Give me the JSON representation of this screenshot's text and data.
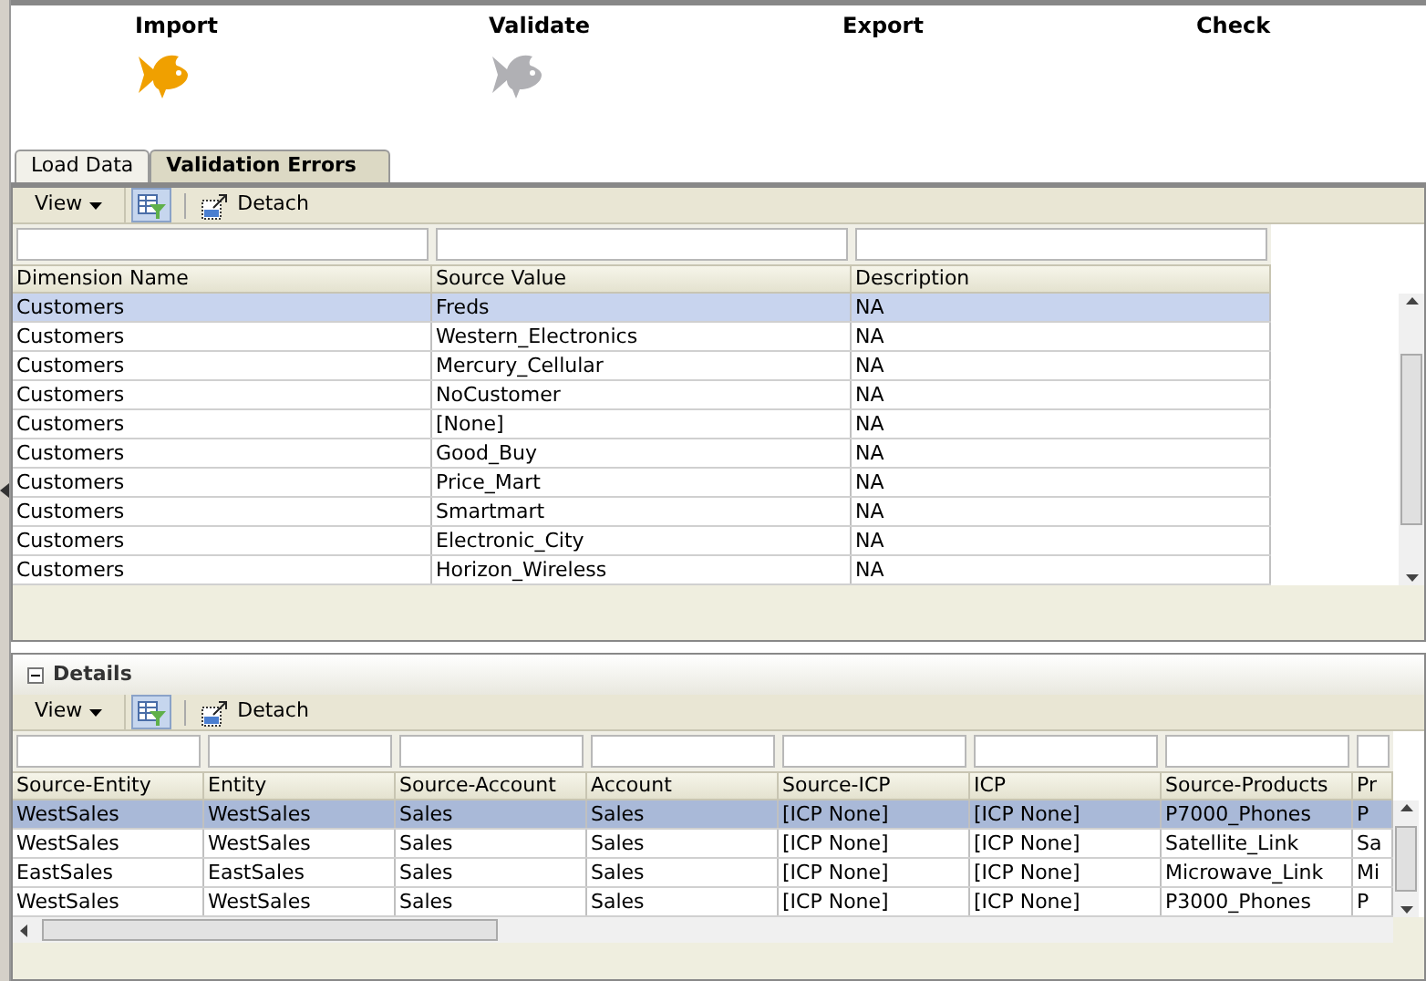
{
  "steps": [
    {
      "label": "Import",
      "kind": "done"
    },
    {
      "label": "Validate",
      "kind": "pending"
    },
    {
      "label": "Export",
      "kind": "plain"
    },
    {
      "label": "Check",
      "kind": "plain"
    }
  ],
  "tabs": [
    {
      "label": "Load Data",
      "selected": false
    },
    {
      "label": "Validation Errors",
      "selected": true
    }
  ],
  "errors": {
    "toolbar": {
      "view": "View",
      "detach": "Detach"
    },
    "columns": [
      "Dimension Name",
      "Source Value",
      "Description"
    ],
    "rows": [
      {
        "cells": [
          "Customers",
          "Freds",
          "NA"
        ],
        "selected": true
      },
      {
        "cells": [
          "Customers",
          "Western_Electronics",
          "NA"
        ],
        "selected": false
      },
      {
        "cells": [
          "Customers",
          "Mercury_Cellular",
          "NA"
        ],
        "selected": false
      },
      {
        "cells": [
          "Customers",
          "NoCustomer",
          "NA"
        ],
        "selected": false
      },
      {
        "cells": [
          "Customers",
          "[None]",
          "NA"
        ],
        "selected": false
      },
      {
        "cells": [
          "Customers",
          "Good_Buy",
          "NA"
        ],
        "selected": false
      },
      {
        "cells": [
          "Customers",
          "Price_Mart",
          "NA"
        ],
        "selected": false
      },
      {
        "cells": [
          "Customers",
          "Smartmart",
          "NA"
        ],
        "selected": false
      },
      {
        "cells": [
          "Customers",
          "Electronic_City",
          "NA"
        ],
        "selected": false
      },
      {
        "cells": [
          "Customers",
          "Horizon_Wireless",
          "NA"
        ],
        "selected": false
      }
    ]
  },
  "details": {
    "title": "Details",
    "expanded": true,
    "toolbar": {
      "view": "View",
      "detach": "Detach"
    },
    "columns": [
      "Source-Entity",
      "Entity",
      "Source-Account",
      "Account",
      "Source-ICP",
      "ICP",
      "Source-Products",
      "Pr"
    ],
    "rows": [
      {
        "cells": [
          "WestSales",
          "WestSales",
          "Sales",
          "Sales",
          "[ICP None]",
          "[ICP None]",
          "P7000_Phones",
          "P"
        ],
        "selected": true
      },
      {
        "cells": [
          "WestSales",
          "WestSales",
          "Sales",
          "Sales",
          "[ICP None]",
          "[ICP None]",
          "Satellite_Link",
          "Sa"
        ],
        "selected": false
      },
      {
        "cells": [
          "EastSales",
          "EastSales",
          "Sales",
          "Sales",
          "[ICP None]",
          "[ICP None]",
          "Microwave_Link",
          "Mi"
        ],
        "selected": false
      },
      {
        "cells": [
          "WestSales",
          "WestSales",
          "Sales",
          "Sales",
          "[ICP None]",
          "[ICP None]",
          "P3000_Phones",
          "P"
        ],
        "selected": false
      }
    ]
  }
}
